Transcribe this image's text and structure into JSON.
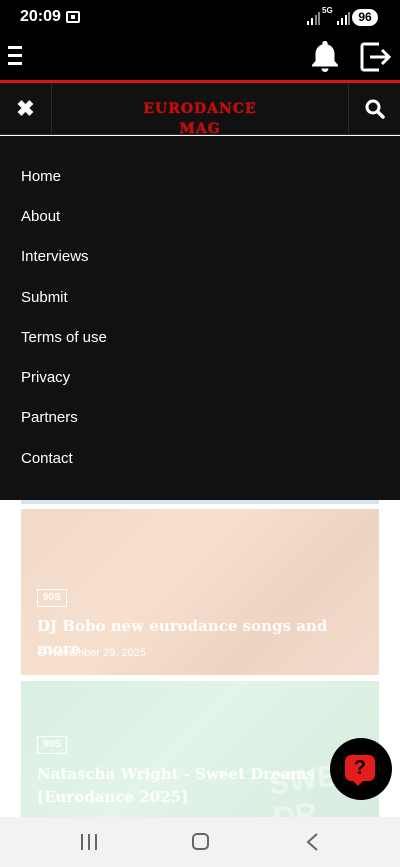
{
  "status_bar": {
    "time": "20:09",
    "network": "5G",
    "battery": "96"
  },
  "app_header": {
    "menu_icon": "hamburger-icon",
    "bell_icon": "bell-icon",
    "logout_icon": "logout-icon"
  },
  "site_header": {
    "logo_text": "EURODANCE MAG",
    "close_icon": "close-icon",
    "search_icon": "search-icon"
  },
  "menu": {
    "items": [
      "Home",
      "About",
      "Interviews",
      "Submit",
      "Terms of use",
      "Privacy",
      "Partners",
      "Contact"
    ]
  },
  "articles": [
    {
      "category": "90S",
      "title": "DJ Bobo new eurodance songs and more",
      "date": "November 29, 2025"
    },
    {
      "category": "90S",
      "title": "Natascha Wright - Sweet Dreams [Eurodance 2025]",
      "bg_text": "SWEET DR"
    }
  ],
  "help_button": {
    "label": "?"
  },
  "colors": {
    "accent_red": "#d81414",
    "menu_bg": "#111111"
  }
}
